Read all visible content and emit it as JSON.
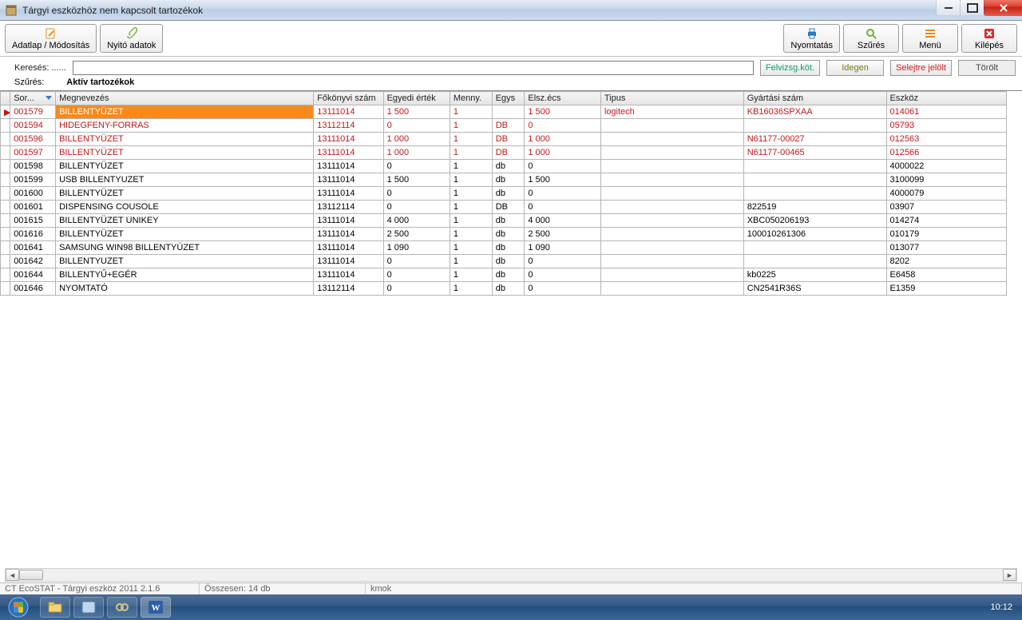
{
  "window": {
    "title": "Tárgyi eszközhöz nem kapcsolt tartozékok"
  },
  "toolbar": {
    "adatlap": "Adatlap / Módosítás",
    "nyito": "Nyitó adatok",
    "nyomtatas": "Nyomtatás",
    "szures": "Szűrés",
    "menu": "Menü",
    "kilepes": "Kilépés"
  },
  "search": {
    "label": "Keresés: ......",
    "value": "",
    "legend": {
      "felvizsg": "Felvizsg.köt.",
      "idegen": "Idegen",
      "selejtre": "Selejtre jelölt",
      "torolt": "Törölt"
    }
  },
  "filter": {
    "label": "Szűrés:",
    "active": "Aktív tartozékok"
  },
  "columns": {
    "sor": "Sor...",
    "megnevezes": "Megnevezés",
    "fokonyvi": "Főkönyvi szám",
    "egyedi": "Egyedi érték",
    "menny": "Menny.",
    "egys": "Egys",
    "elsz": "Elsz.écs",
    "tipus": "Tipus",
    "gyartasi": "Gyártási szám",
    "eszkoz": "Eszköz"
  },
  "rows": [
    {
      "mark": "▶",
      "sor": "001579",
      "name": "BILLENTYÜZET",
      "fk": "13111014",
      "egy": "1 500",
      "men": "1",
      "egys": "",
      "elsz": "1 500",
      "tip": "logitech",
      "gy": "KB16036SPXAA",
      "esz": "014061",
      "red": true,
      "sel": true
    },
    {
      "sor": "001594",
      "name": "HIDEGFENY-FORRAS",
      "fk": "13112114",
      "egy": "0",
      "men": "1",
      "egys": "DB",
      "elsz": "0",
      "tip": "",
      "gy": "",
      "esz": "05793",
      "red": true
    },
    {
      "sor": "001596",
      "name": "BILLENTYÜZET",
      "fk": "13111014",
      "egy": "1 000",
      "men": "1",
      "egys": "DB",
      "elsz": "1 000",
      "tip": "",
      "gy": "N61177-00027",
      "esz": "012563",
      "red": true
    },
    {
      "sor": "001597",
      "name": "BILLENTYÜZET",
      "fk": "13111014",
      "egy": "1 000",
      "men": "1",
      "egys": "DB",
      "elsz": "1 000",
      "tip": "",
      "gy": "N61177-00465",
      "esz": "012566",
      "red": true
    },
    {
      "sor": "001598",
      "name": "BILLENTYÜZET",
      "fk": "13111014",
      "egy": "0",
      "men": "1",
      "egys": "db",
      "elsz": "0",
      "tip": "",
      "gy": "",
      "esz": "4000022"
    },
    {
      "sor": "001599",
      "name": "USB BILLENTYUZET",
      "fk": "13111014",
      "egy": "1 500",
      "men": "1",
      "egys": "db",
      "elsz": "1 500",
      "tip": "",
      "gy": "",
      "esz": "3100099"
    },
    {
      "sor": "001600",
      "name": "BILLENTYÜZET",
      "fk": "13111014",
      "egy": "0",
      "men": "1",
      "egys": "db",
      "elsz": "0",
      "tip": "",
      "gy": "",
      "esz": "4000079"
    },
    {
      "sor": "001601",
      "name": "DISPENSING COUSOLE",
      "fk": "13112114",
      "egy": "0",
      "men": "1",
      "egys": "DB",
      "elsz": "0",
      "tip": "",
      "gy": "822519",
      "esz": "03907"
    },
    {
      "sor": "001615",
      "name": "BILLENTYÜZET UNIKEY",
      "fk": "13111014",
      "egy": "4 000",
      "men": "1",
      "egys": "db",
      "elsz": "4 000",
      "tip": "",
      "gy": "XBC050206193",
      "esz": "014274"
    },
    {
      "sor": "001616",
      "name": "BILLENTYÜZET",
      "fk": "13111014",
      "egy": "2 500",
      "men": "1",
      "egys": "db",
      "elsz": "2 500",
      "tip": "",
      "gy": "100010261306",
      "esz": "010179"
    },
    {
      "sor": "001641",
      "name": "SAMSUNG WIN98 BILLENTYÜZET",
      "fk": "13111014",
      "egy": "1 090",
      "men": "1",
      "egys": "db",
      "elsz": "1 090",
      "tip": "",
      "gy": "",
      "esz": "013077"
    },
    {
      "sor": "001642",
      "name": "BILLENTYUZET",
      "fk": "13111014",
      "egy": "0",
      "men": "1",
      "egys": "db",
      "elsz": "0",
      "tip": "",
      "gy": "",
      "esz": " 8202"
    },
    {
      "sor": "001644",
      "name": "BILLENTYŰ+EGÉR",
      "fk": "13111014",
      "egy": "0",
      "men": "1",
      "egys": "db",
      "elsz": "0",
      "tip": "",
      "gy": "kb0225",
      "esz": "E6458"
    },
    {
      "sor": "001646",
      "name": "NYOMTATÓ",
      "fk": "13112114",
      "egy": "0",
      "men": "1",
      "egys": "db",
      "elsz": "0",
      "tip": "",
      "gy": "CN2541R36S",
      "esz": "E1359"
    }
  ],
  "status": {
    "app": "CT EcoSTAT - Tárgyi eszköz 2011 2.1.6",
    "count": "Összesen: 14 db",
    "extra": "kmok"
  },
  "tray": {
    "time": "10:12"
  }
}
